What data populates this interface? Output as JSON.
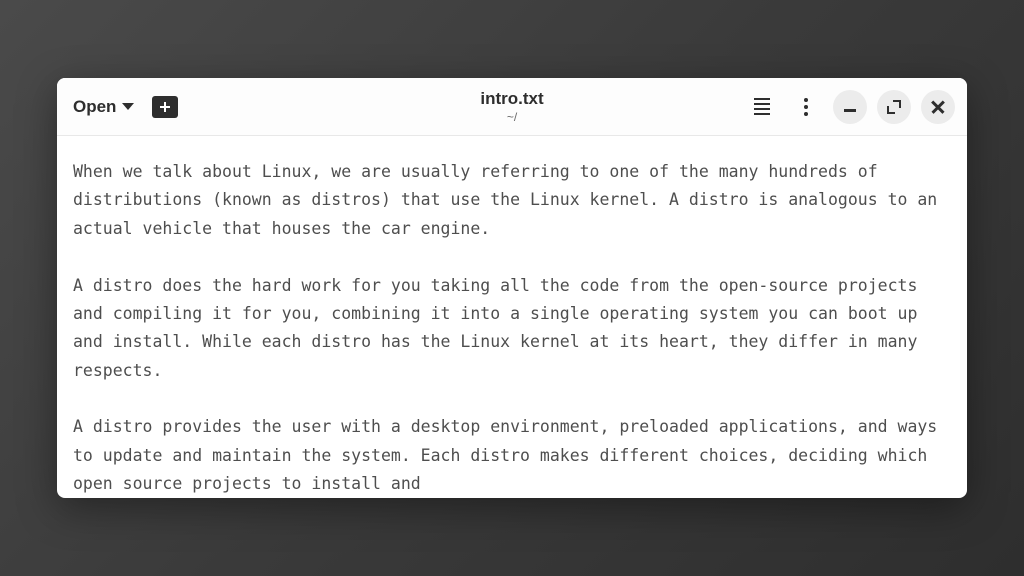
{
  "toolbar": {
    "open_label": "Open"
  },
  "header": {
    "filename": "intro.txt",
    "path": "~/"
  },
  "document": {
    "text": "When we talk about Linux, we are usually referring to one of the many hundreds of distributions (known as distros) that use the Linux kernel. A distro is analogous to an actual vehicle that houses the car engine.\n\nA distro does the hard work for you taking all the code from the open-source projects and compiling it for you, combining it into a single operating system you can boot up and install. While each distro has the Linux kernel at its heart, they differ in many respects.\n\nA distro provides the user with a desktop environment, preloaded applications, and ways to update and maintain the system. Each distro makes different choices, deciding which open source projects to install and"
  }
}
